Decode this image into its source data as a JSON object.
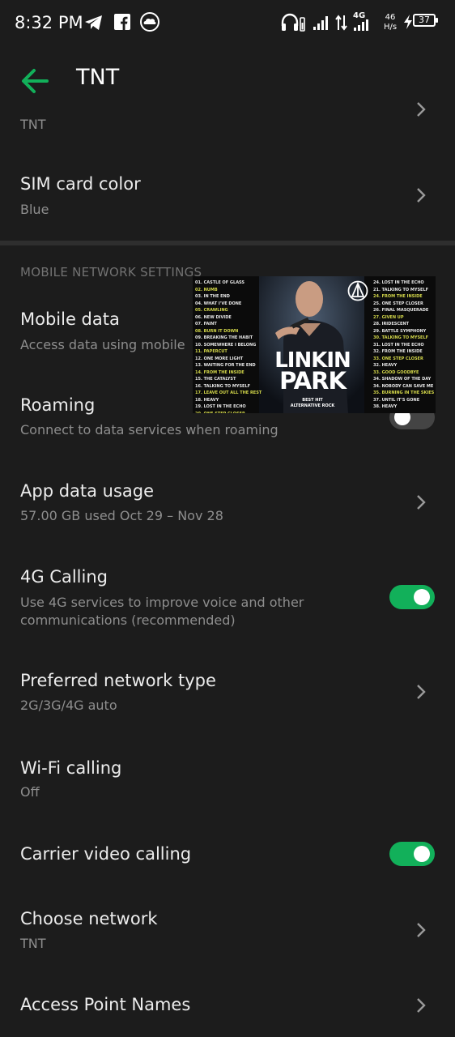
{
  "status_bar": {
    "time": "8:32 PM",
    "net_label": "4G",
    "speed_value": "46",
    "speed_unit": "H/s",
    "battery": "37",
    "icons": [
      "telegram-icon",
      "facebook-icon",
      "cloud-icon",
      "headphones-icon",
      "signal-icon",
      "data-arrows-icon",
      "signal-icon",
      "charging-icon",
      "battery-icon"
    ]
  },
  "header": {
    "title": "TNT"
  },
  "top_partial": {
    "value": "TNT"
  },
  "sim_color": {
    "title": "SIM card color",
    "value": "Blue"
  },
  "section": {
    "title": "MOBILE NETWORK SETTINGS"
  },
  "mobile_data": {
    "title": "Mobile data",
    "subtitle": "Access data using mobile"
  },
  "roaming": {
    "title": "Roaming",
    "subtitle": "Connect to data services when roaming",
    "enabled": false
  },
  "app_data": {
    "title": "App data usage",
    "subtitle": "57.00 GB used Oct 29 – Nov 28"
  },
  "calling_4g": {
    "title": "4G Calling",
    "subtitle_1": "Use 4G services to improve voice and other",
    "subtitle_2": "communications (recommended)",
    "enabled": true
  },
  "preferred_network": {
    "title": "Preferred network type",
    "value": "2G/3G/4G auto"
  },
  "wifi_calling": {
    "title": "Wi-Fi calling",
    "value": "Off"
  },
  "carrier_video": {
    "title": "Carrier video calling",
    "enabled": true
  },
  "choose_network": {
    "title": "Choose network",
    "value": "TNT"
  },
  "apn": {
    "title": "Access Point Names"
  },
  "overlay": {
    "brand_line1": "LINKIN",
    "brand_line2": "PARK",
    "caption_1": "BEST HIT",
    "caption_2": "ALTERNATIVE ROCK",
    "left_tracks": [
      "01. CASTLE OF GLASS",
      "02. NUMB",
      "03. IN THE END",
      "04. WHAT I'VE DONE",
      "05. CRAWLING",
      "06. NEW DIVIDE",
      "07. FAINT",
      "08. BURN IT DOWN",
      "09. BREAKING THE HABIT",
      "10. SOMEWHERE I BELONG",
      "11. PAPERCUT",
      "12. ONE MORE LIGHT",
      "13. WAITING FOR THE END",
      "14. FROM THE INSIDE",
      "15. THE CATALYST",
      "16. TALKING TO MYSELF",
      "17. LEAVE OUT ALL THE REST",
      "18. HEAVY",
      "19. LOST IN THE ECHO",
      "20. ONE STEP CLOSER"
    ],
    "right_tracks": [
      "24. LOST IN THE ECHO",
      "21. TALKING TO MYSELF",
      "24. FROM THE INSIDE",
      "25. ONE STEP CLOSER",
      "26. FINAL MASQUERADE",
      "27. GIVEN UP",
      "28. IRIDESCENT",
      "29. BATTLE SYMPHONY",
      "30. TALKING TO MYSELF",
      "31. LOST IN THE ECHO",
      "32. FROM THE INSIDE",
      "33. ONE STEP CLOSER",
      "32. HEAVY",
      "33. GOOD GOODBYE",
      "34. SHADOW OF THE DAY",
      "34. NOBODY CAN SAVE ME",
      "35. BURNING IN THE SKIES",
      "37. UNTIL IT'S GONE",
      "38. HEAVY"
    ],
    "left_highlight": [
      1,
      4,
      7,
      10,
      13,
      16,
      19
    ],
    "right_highlight": [
      2,
      5,
      8,
      11,
      13,
      16
    ]
  },
  "colors": {
    "background": "#1c1c1c",
    "accent": "#12b05a",
    "secondary_text": "#8e8e8e"
  }
}
